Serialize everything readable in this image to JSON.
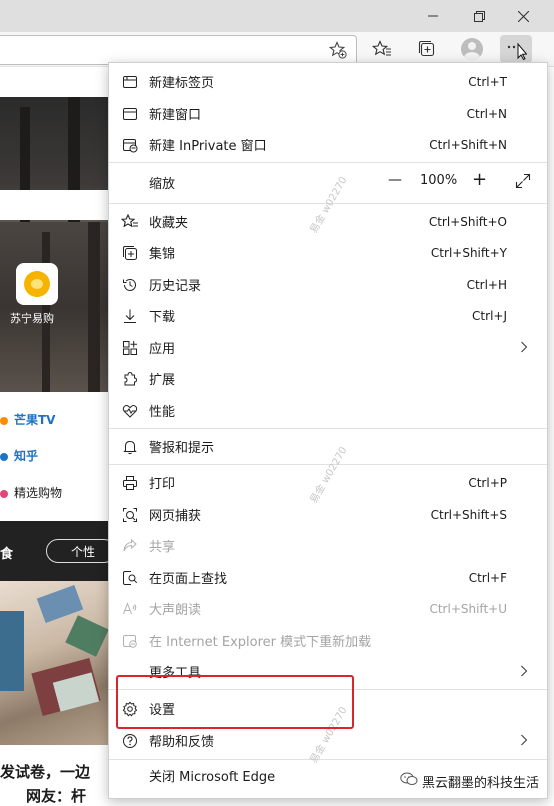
{
  "window_controls": {
    "minimize_icon": "minimize-icon",
    "restore_icon": "restore-icon",
    "close_icon": "close-icon"
  },
  "toolbar": {
    "address_value": ""
  },
  "page_behind": {
    "app_label": "苏宁易购",
    "links": [
      "芒果TV",
      "知乎",
      "精选购物"
    ],
    "band_text": "食",
    "band_pill": "个性",
    "bottom_lines": [
      "发试卷，一边",
      "网友：杆"
    ]
  },
  "menu": {
    "new_tab": {
      "label": "新建标签页",
      "shortcut": "Ctrl+T"
    },
    "new_window": {
      "label": "新建窗口",
      "shortcut": "Ctrl+N"
    },
    "new_inprivate": {
      "label": "新建 InPrivate 窗口",
      "shortcut": "Ctrl+Shift+N"
    },
    "zoom": {
      "label": "缩放",
      "value": "100%",
      "minus": "—",
      "plus": "+"
    },
    "favorites": {
      "label": "收藏夹",
      "shortcut": "Ctrl+Shift+O"
    },
    "collections": {
      "label": "集锦",
      "shortcut": "Ctrl+Shift+Y"
    },
    "history": {
      "label": "历史记录",
      "shortcut": "Ctrl+H"
    },
    "downloads": {
      "label": "下载",
      "shortcut": "Ctrl+J"
    },
    "apps": {
      "label": "应用"
    },
    "extensions": {
      "label": "扩展"
    },
    "performance": {
      "label": "性能"
    },
    "alerts": {
      "label": "警报和提示"
    },
    "print": {
      "label": "打印",
      "shortcut": "Ctrl+P"
    },
    "web_capture": {
      "label": "网页捕获",
      "shortcut": "Ctrl+Shift+S"
    },
    "share": {
      "label": "共享"
    },
    "find": {
      "label": "在页面上查找",
      "shortcut": "Ctrl+F"
    },
    "read_aloud": {
      "label": "大声朗读",
      "shortcut": "Ctrl+Shift+U"
    },
    "ie_mode": {
      "label": "在 Internet Explorer 模式下重新加载"
    },
    "more_tools": {
      "label": "更多工具"
    },
    "settings": {
      "label": "设置"
    },
    "help": {
      "label": "帮助和反馈"
    },
    "close_edge": {
      "label": "关闭 Microsoft Edge"
    }
  },
  "watermark": [
    "易金",
    "w02270"
  ],
  "overlay": {
    "wechat_label": "黑云翻墨的科技生活"
  },
  "colors": {
    "highlight_box": "#d9262d",
    "link_blue": "#1a73c8"
  }
}
